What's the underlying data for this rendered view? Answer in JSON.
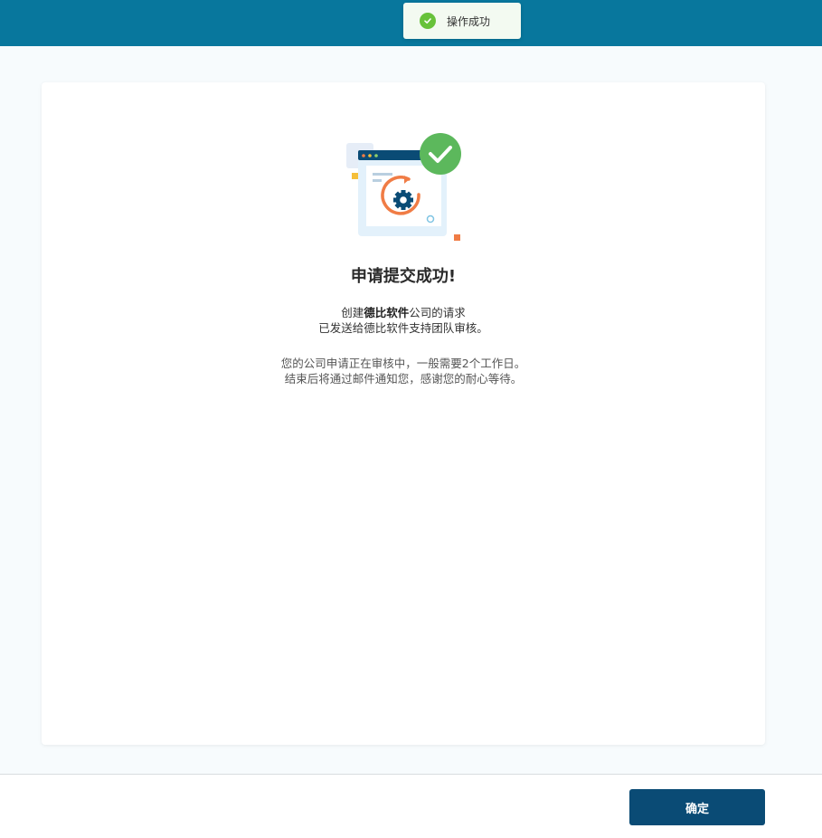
{
  "toast": {
    "text": "操作成功",
    "icon": "check-circle-icon",
    "color": "#67c23a"
  },
  "result": {
    "title": "申请提交成功!",
    "line1_prefix": "创建",
    "company_name": "德比软件",
    "line1_suffix": "公司的请求",
    "line2": "已发送给德比软件支持团队审核。",
    "line3": "您的公司申请正在审核中，一般需要2个工作日。",
    "line4": "结束后将通过邮件通知您，感谢您的耐心等待。"
  },
  "footer": {
    "confirm_label": "确定"
  },
  "colors": {
    "topbar": "#08779d",
    "primary": "#0a4b75",
    "success": "#5cb85c",
    "accent": "#f07c45"
  }
}
